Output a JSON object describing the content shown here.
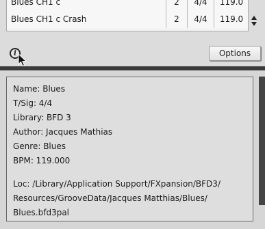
{
  "groove_list": {
    "rows": [
      {
        "name": "Blues CH1 c",
        "bars": "2",
        "sig": "4/4",
        "bpm": "119.0"
      },
      {
        "name": "Blues CH1 c Crash",
        "bars": "2",
        "sig": "4/4",
        "bpm": "119.0"
      }
    ]
  },
  "toolbar": {
    "info_icon_glyph": "i",
    "options_label": "Options"
  },
  "info_panel": {
    "name": "Name: Blues",
    "tsig": "T/Sig: 4/4",
    "library": "Library: BFD 3",
    "author": "Author: Jacques Mathias",
    "genre": "Genre: Blues",
    "bpm": "BPM: 119.000",
    "loc_line1": "Loc: /Library/Application Support/FXpansion/BFD3/",
    "loc_line2": "Resources/GrooveData/Jacques Matthias/Blues/",
    "loc_line3": "Blues.bfd3pal"
  },
  "icons": {
    "info": "info-icon",
    "sort": "sort-arrows-icon",
    "cursor": "mouse-pointer-icon"
  }
}
